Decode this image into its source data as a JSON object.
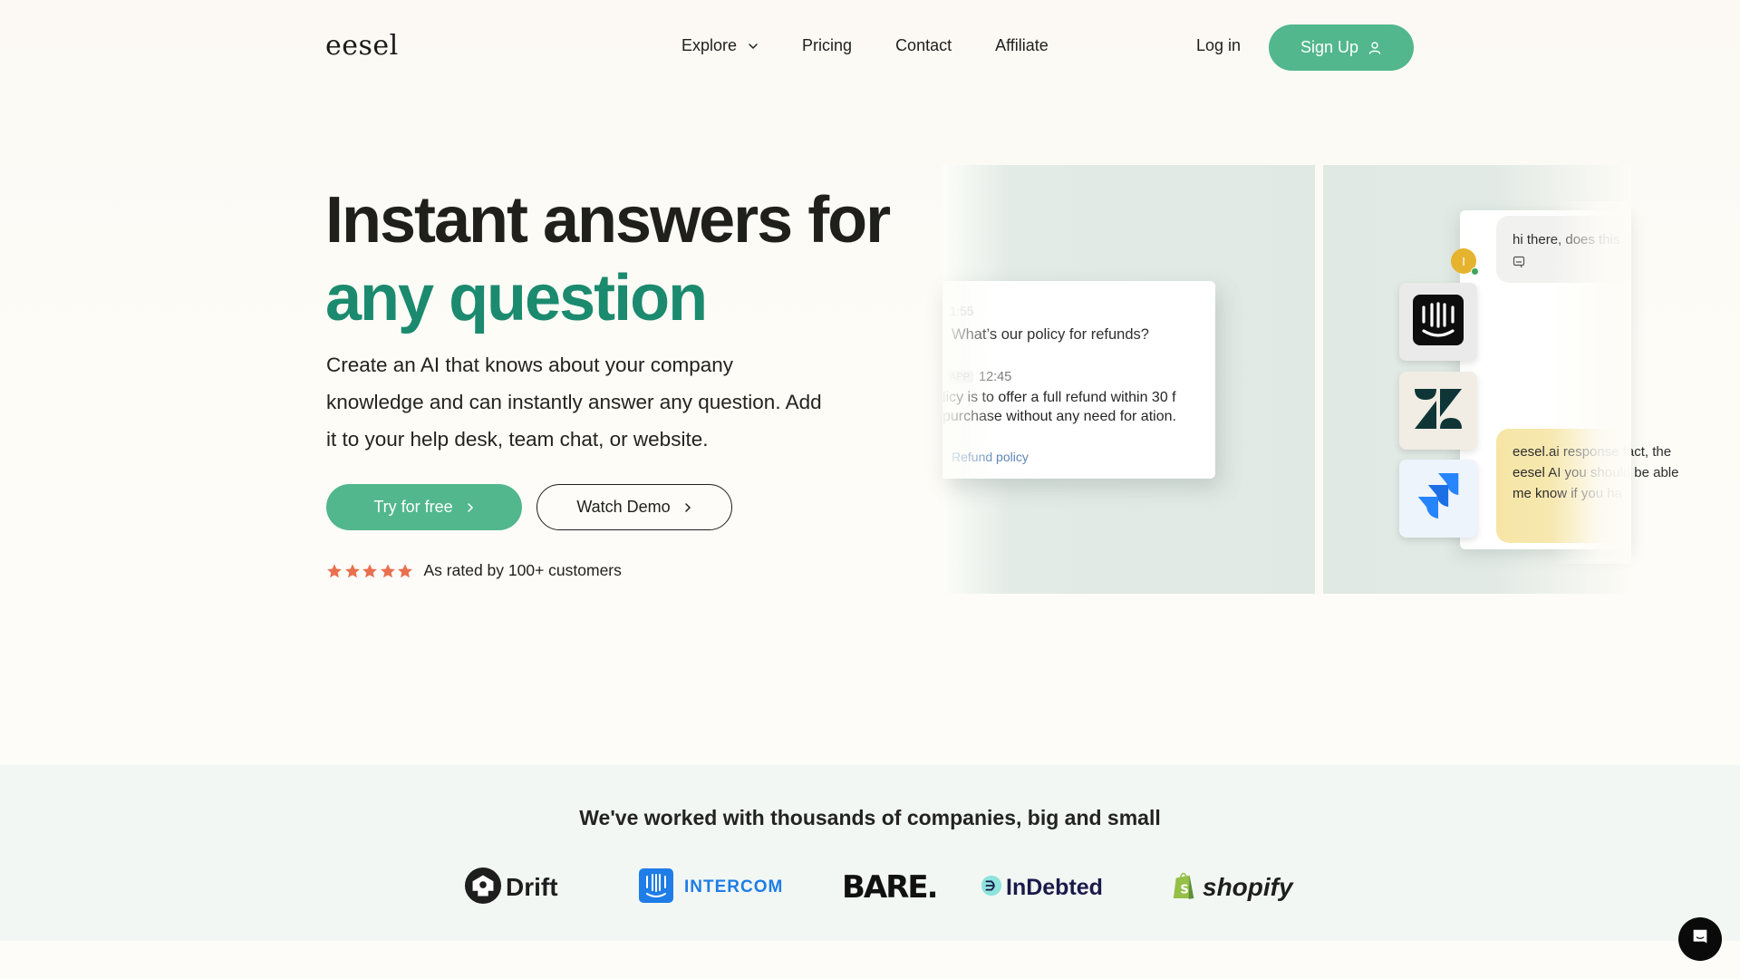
{
  "nav": {
    "logo": "eesel",
    "links": [
      {
        "label": "Explore",
        "has_dropdown": true,
        "icon": "chevron-down-icon"
      },
      {
        "label": "Pricing"
      },
      {
        "label": "Contact"
      },
      {
        "label": "Affiliate"
      }
    ],
    "login_label": "Log in",
    "signup_label": "Sign Up",
    "signup_icon": "user-icon"
  },
  "hero": {
    "title_line1": "Instant answers for",
    "title_line2": "any question",
    "subtitle": "Create an AI that knows about your company knowledge and can instantly answer any question. Add it to your help desk, team chat, or website.",
    "primary_cta": "Try for free",
    "secondary_cta": "Watch Demo",
    "rating": {
      "stars": 5,
      "max_stars": 5,
      "text": "As rated by 100+ customers"
    }
  },
  "mockup": {
    "slack_card": {
      "time1": "1:55",
      "question": "What’s our policy for refunds?",
      "app_badge": "APP",
      "time2": "12:45",
      "answer": "licy is to offer a full refund within 30 f purchase without any need for ation.",
      "link": "Refund policy"
    },
    "widget": {
      "user_initial": "I",
      "user_message": "hi there, does this",
      "ai_response": "eesel.ai response fact, the eesel AI you should be able me know if you ha"
    },
    "integrations": [
      {
        "name": "Intercom",
        "icon": "intercom-icon"
      },
      {
        "name": "Zendesk",
        "icon": "zendesk-icon"
      },
      {
        "name": "Jira",
        "icon": "jira-icon"
      }
    ]
  },
  "customers": {
    "heading": "We've worked with thousands of companies, big and small",
    "logos": [
      {
        "name": "Drift"
      },
      {
        "name": "INTERCOM"
      },
      {
        "name": "BARE."
      },
      {
        "name": "InDebted"
      },
      {
        "name": "shopify"
      }
    ]
  },
  "colors": {
    "accent": "#52b78d",
    "accent_text": "#1b8a6e",
    "star": "#e8704f"
  }
}
